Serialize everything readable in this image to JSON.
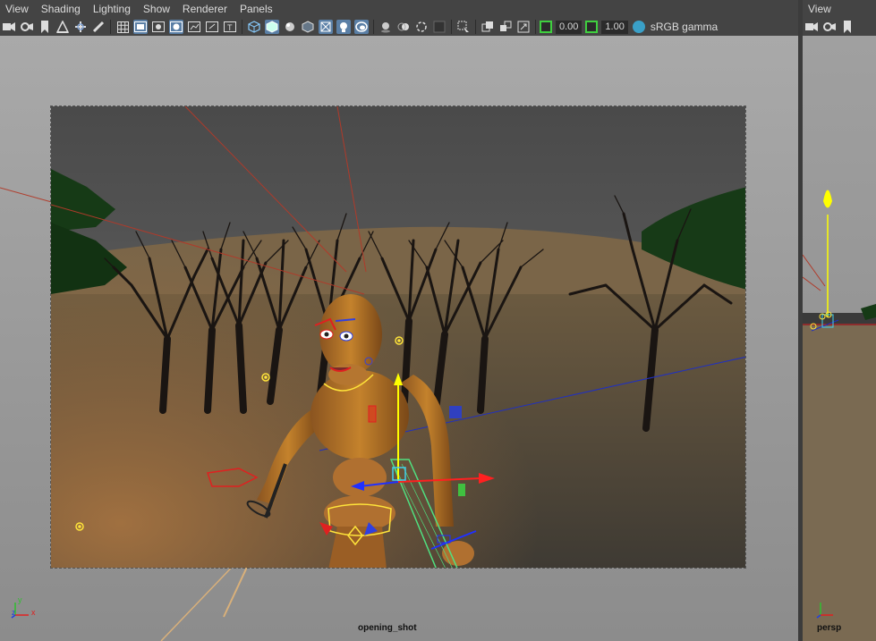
{
  "main_menu": {
    "items": [
      "View",
      "Shading",
      "Lighting",
      "Show",
      "Renderer",
      "Panels"
    ]
  },
  "toolbar": {
    "exposure_value": "0.00",
    "gamma_value": "1.00",
    "color_space_label": "sRGB gamma"
  },
  "viewport": {
    "camera_name": "opening_shot",
    "axis_x": "x",
    "axis_y": "y",
    "axis_z": "z"
  },
  "side_panel": {
    "menu_label": "View",
    "camera_name": "persp"
  },
  "colors": {
    "panel_bg": "#444444",
    "active_button": "#5a7fa6",
    "exposure_border": "#3fcf3f",
    "manipulator_y": "#ffff00",
    "manipulator_x": "#ff2020",
    "manipulator_z": "#2020ff"
  }
}
